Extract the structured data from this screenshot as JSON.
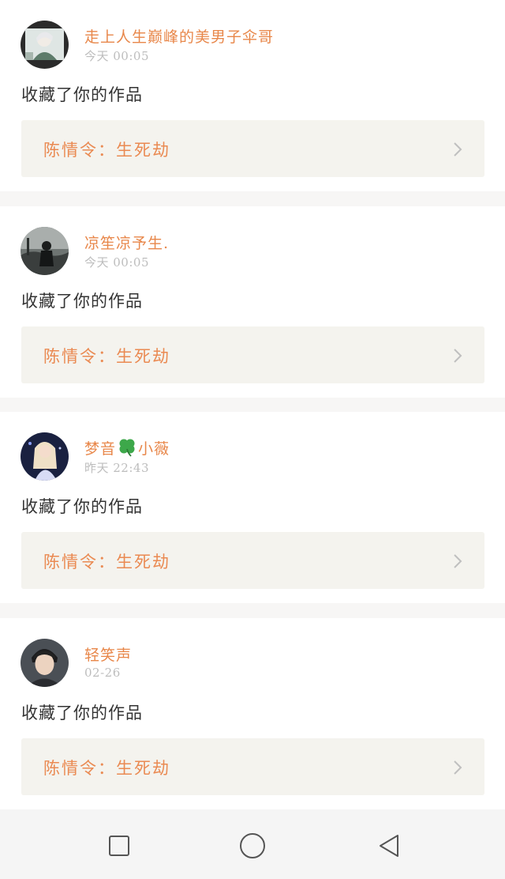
{
  "notifications": [
    {
      "username": "走上人生巅峰的美男子伞哥",
      "time": "今天 00:05",
      "action": "收藏了你的作品",
      "work_title": "陈情令：生死劫",
      "avatar_icon": "avatar-man-white-hair"
    },
    {
      "username": "凉笙凉予生.",
      "time": "今天 00:05",
      "action": "收藏了你的作品",
      "work_title": "陈情令：生死劫",
      "avatar_icon": "avatar-silhouette-dark"
    },
    {
      "username_prefix": "梦音",
      "username_suffix": "小薇",
      "username_emoji": "four-leaf-clover-icon",
      "time": "昨天 22:43",
      "action": "收藏了你的作品",
      "work_title": "陈情令：生死劫",
      "avatar_icon": "avatar-girl-blonde"
    },
    {
      "username": "轻笑声",
      "time": "02-26",
      "action": "收藏了你的作品",
      "work_title": "陈情令：生死劫",
      "avatar_icon": "avatar-man-portrait"
    }
  ],
  "navbar": {
    "icons": [
      "recent-apps-icon",
      "home-icon",
      "back-icon"
    ]
  },
  "colors": {
    "accent": "#e8874a",
    "card_link_bg": "#f4f3ee",
    "timestamp": "#bdbdbd"
  }
}
